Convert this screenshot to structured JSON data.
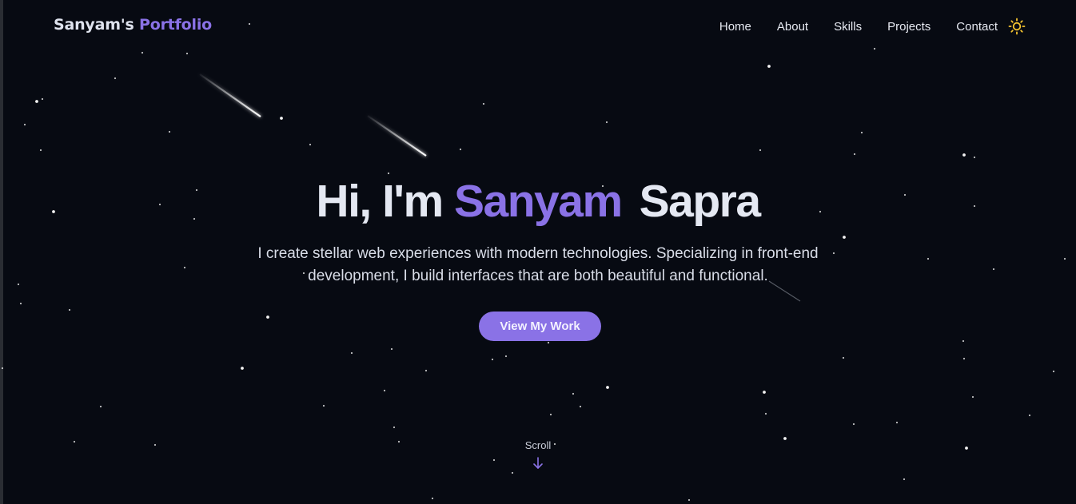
{
  "brand": {
    "name": "Sanyam's",
    "accent": "Portfolio"
  },
  "nav": {
    "items": [
      {
        "label": "Home"
      },
      {
        "label": "About"
      },
      {
        "label": "Skills"
      },
      {
        "label": "Projects"
      },
      {
        "label": "Contact"
      }
    ],
    "theme_icon": "sun-icon"
  },
  "hero": {
    "greeting": "Hi, I'm",
    "first_name": "Sanyam",
    "last_name": "Sapra",
    "subtitle": "I create stellar web experiences with modern technologies. Specializing in front-end development, I build interfaces that are both beautiful and functional.",
    "cta_label": "View My Work"
  },
  "scroll": {
    "label": "Scroll",
    "icon": "arrow-down-icon"
  },
  "colors": {
    "background": "#070a12",
    "accent": "#8a72e6",
    "text": "#e4e8f2",
    "sun": "#f4c430"
  }
}
